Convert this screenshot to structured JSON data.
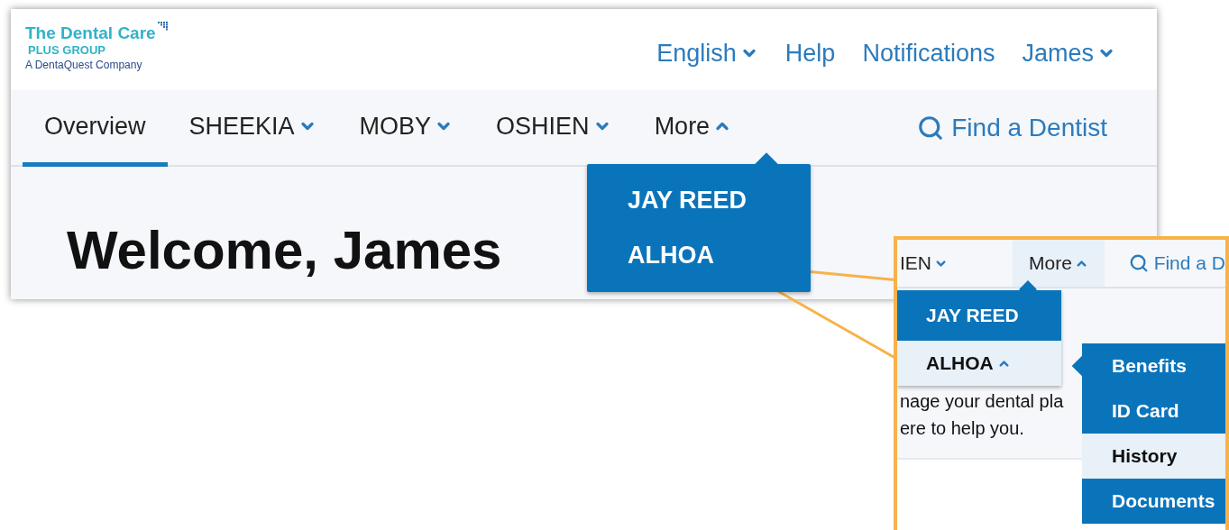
{
  "logo": {
    "name": "The Dental Care",
    "sub": "PLUS GROUP",
    "tagline": "A DentaQuest Company"
  },
  "top_links": [
    {
      "label": "English",
      "expanded": false
    },
    {
      "label": "Help"
    },
    {
      "label": "Notifications"
    },
    {
      "label": "James",
      "expanded": false
    }
  ],
  "nav": {
    "tabs": [
      {
        "label": "Overview",
        "selected": true
      },
      {
        "label": "SHEEKIA",
        "selected": false,
        "expanded": false
      },
      {
        "label": "MOBY",
        "selected": false,
        "expanded": false
      },
      {
        "label": "OSHIEN",
        "selected": false,
        "expanded": false
      },
      {
        "label": "More",
        "selected": false,
        "expanded": true
      }
    ],
    "search_link": "Find a Dentist",
    "menu": [
      {
        "label": "JAY REED"
      },
      {
        "label": "ALHOA"
      }
    ]
  },
  "heading": "Welcome, James",
  "callout": {
    "tabs": [
      {
        "label": "IEN",
        "highlighted": false,
        "expanded": false
      },
      {
        "label": "More",
        "highlighted": true,
        "expanded": true
      }
    ],
    "search_link": "Find a D",
    "menu": [
      {
        "label": "JAY REED",
        "highlighted": false
      },
      {
        "label": "ALHOA",
        "highlighted": true,
        "expanded": true
      }
    ],
    "body_lines": [
      "nage your dental pla",
      "ere to help you."
    ],
    "submenu": [
      {
        "label": "Benefits",
        "highlighted": false
      },
      {
        "label": "ID Card",
        "highlighted": false
      },
      {
        "label": "History",
        "highlighted": true
      },
      {
        "label": "Documents",
        "highlighted": false
      }
    ]
  }
}
